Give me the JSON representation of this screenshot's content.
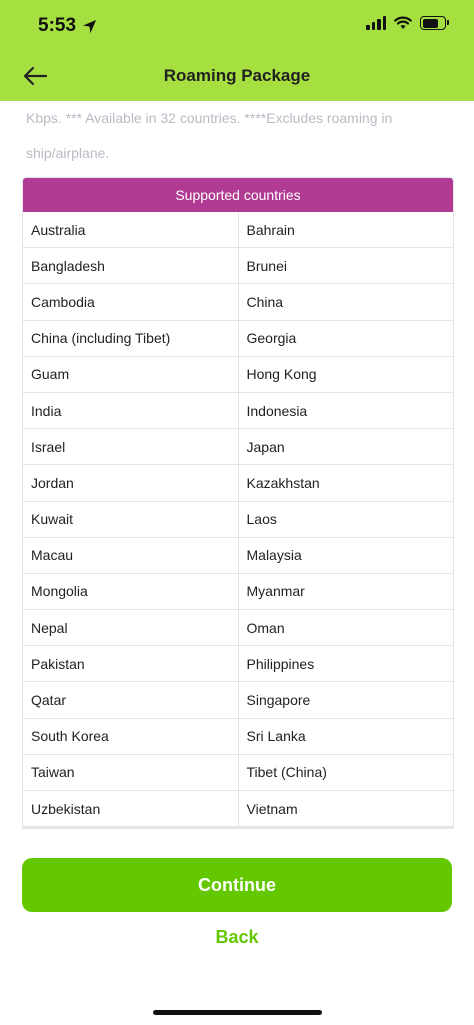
{
  "status_bar": {
    "time": "5:53",
    "location_icon": "location-arrow-icon",
    "signal_icon": "signal-icon",
    "wifi_icon": "wifi-icon",
    "battery_icon": "battery-icon"
  },
  "nav": {
    "back_icon": "back-arrow-icon",
    "title": "Roaming Package"
  },
  "note": "Kbps. *** Available in 32 countries. ****Excludes roaming in ship/airplane.",
  "table": {
    "header": "Supported countries",
    "rows": [
      [
        "Australia",
        "Bahrain"
      ],
      [
        "Bangladesh",
        "Brunei"
      ],
      [
        "Cambodia",
        "China"
      ],
      [
        "China (including Tibet)",
        "Georgia"
      ],
      [
        "Guam",
        "Hong Kong"
      ],
      [
        "India",
        "Indonesia"
      ],
      [
        "Israel",
        "Japan"
      ],
      [
        "Jordan",
        "Kazakhstan"
      ],
      [
        "Kuwait",
        "Laos"
      ],
      [
        "Macau",
        "Malaysia"
      ],
      [
        "Mongolia",
        "Myanmar"
      ],
      [
        "Nepal",
        "Oman"
      ],
      [
        "Pakistan",
        "Philippines"
      ],
      [
        "Qatar",
        "Singapore"
      ],
      [
        "South Korea",
        "Sri Lanka"
      ],
      [
        "Taiwan",
        "Tibet (China)"
      ],
      [
        "Uzbekistan",
        "Vietnam"
      ]
    ]
  },
  "actions": {
    "continue_label": "Continue",
    "back_label": "Back"
  },
  "colors": {
    "header_bar": "#a6e040",
    "table_header": "#b13b93",
    "primary": "#64c800"
  }
}
